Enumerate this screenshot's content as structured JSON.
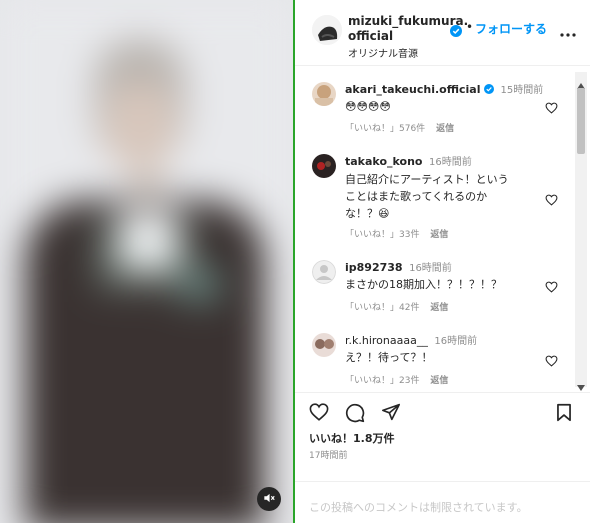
{
  "post": {
    "username_line1": "mizuki_fukumura.",
    "username_line2": "official",
    "follow_label": "フォローする",
    "dot": "•",
    "audio": "オリジナル音源"
  },
  "comments": [
    {
      "user": "akari_takeuchi.official",
      "verified": true,
      "time": "15時間前",
      "text": "😳😳😳😳",
      "likes": "「いいね！」576件",
      "reply": "返信"
    },
    {
      "user": "takako_kono",
      "verified": false,
      "time": "16時間前",
      "text_lines": [
        "自己紹介にアーティスト！という",
        "ことはまた歌ってくれるのか",
        "な！？😆"
      ],
      "likes": "「いいね！」33件",
      "reply": "返信"
    },
    {
      "user": "ip892738",
      "verified": false,
      "time": "16時間前",
      "text": "まさかの18期加入！？！？！？",
      "likes": "「いいね！」42件",
      "reply": "返信"
    },
    {
      "user": "r.k.hironaaaa__",
      "verified": false,
      "time": "16時間前",
      "text": "え？！待って？！",
      "likes": "「いいね！」23件",
      "reply": "返信"
    }
  ],
  "likes_total": "いいね！1.8万件",
  "posted": "17時間前",
  "comments_disabled": "この投稿へのコメントは制限されています。",
  "colors": {
    "accent": "#0095f6",
    "verified": "#0095f6",
    "divider": "#2aa52a"
  },
  "icons": [
    "mute-icon",
    "more-icon",
    "heart-icon",
    "comment-icon",
    "share-icon",
    "bookmark-icon",
    "verified-icon"
  ]
}
